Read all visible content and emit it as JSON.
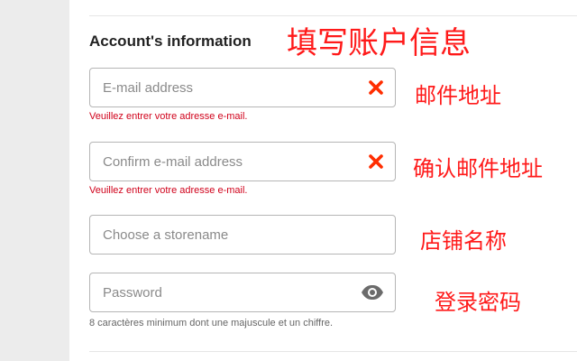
{
  "form": {
    "section_title": "Account's information",
    "email": {
      "placeholder": "E-mail address",
      "error": "Veuillez entrer votre adresse e-mail.",
      "icon": "clear-icon"
    },
    "confirm_email": {
      "placeholder": "Confirm e-mail address",
      "error": "Veuillez entrer votre adresse e-mail.",
      "icon": "clear-icon"
    },
    "storename": {
      "placeholder": "Choose a storename"
    },
    "password": {
      "placeholder": "Password",
      "hint": "8 caractères minimum dont une majuscule et un chiffre.",
      "icon": "eye-icon"
    }
  },
  "annotations": {
    "title": "填写账户信息",
    "email": "邮件地址",
    "confirm_email": "确认邮件地址",
    "storename": "店铺名称",
    "password": "登录密码"
  },
  "colors": {
    "error": "#d0021b",
    "annotation": "#ff1a1a",
    "clear_icon": "#ff2d00",
    "eye_icon": "#6b6b6b"
  }
}
